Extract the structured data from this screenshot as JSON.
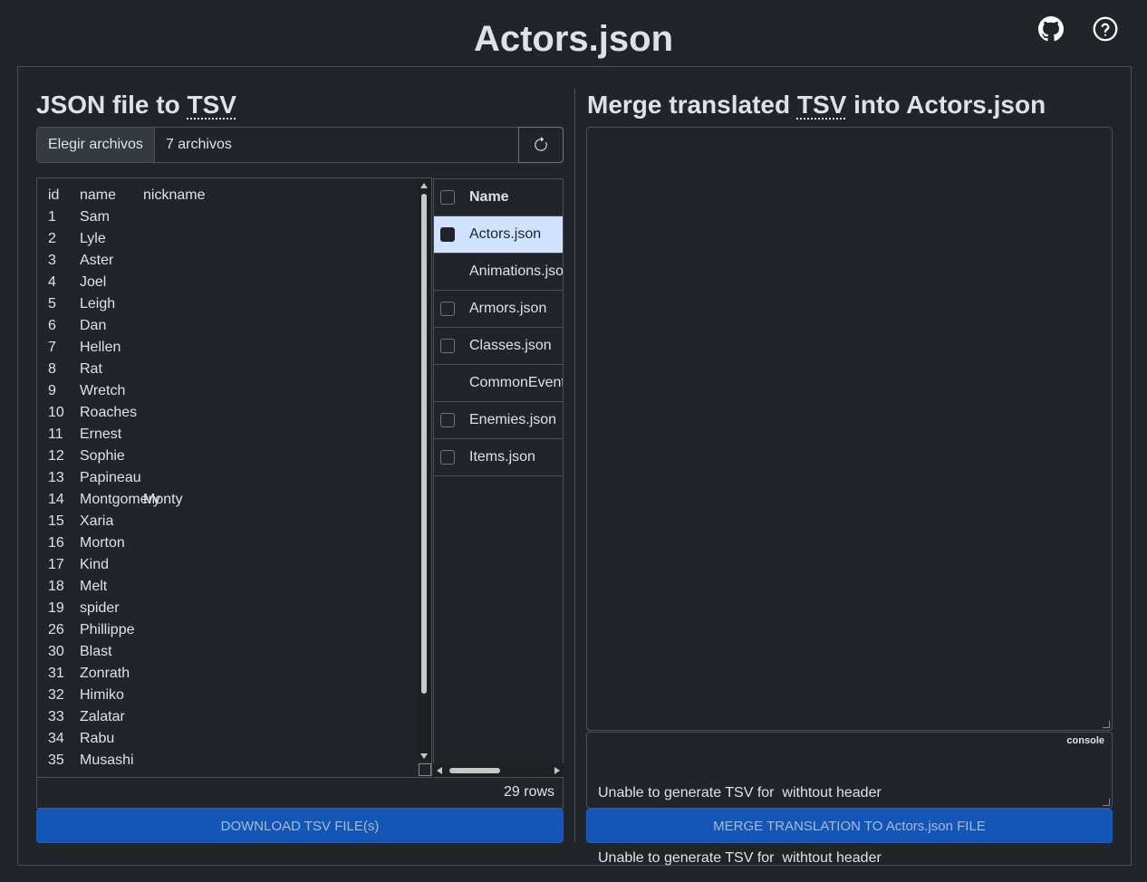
{
  "app": {
    "title": "Actors.json"
  },
  "top_icons": [
    {
      "name": "github-icon"
    },
    {
      "name": "help-circle-icon"
    }
  ],
  "left": {
    "heading_prefix": "JSON file to ",
    "heading_abbr": "TSV",
    "file_input": {
      "button_label": "Elegir archivos",
      "value_text": "7 archivos"
    },
    "refresh_icon": "refresh-icon",
    "tsv": {
      "headers": [
        "id",
        "name",
        "nickname"
      ],
      "rows": [
        [
          "1",
          "Sam",
          ""
        ],
        [
          "2",
          "Lyle",
          ""
        ],
        [
          "3",
          "Aster",
          ""
        ],
        [
          "4",
          "Joel",
          ""
        ],
        [
          "5",
          "Leigh",
          ""
        ],
        [
          "6",
          "Dan",
          ""
        ],
        [
          "7",
          "Hellen",
          ""
        ],
        [
          "8",
          "Rat",
          ""
        ],
        [
          "9",
          "Wretch",
          ""
        ],
        [
          "10",
          "Roaches",
          ""
        ],
        [
          "11",
          "Ernest",
          ""
        ],
        [
          "12",
          "Sophie",
          ""
        ],
        [
          "13",
          "Papineau",
          ""
        ],
        [
          "14",
          "Montgomery",
          "Monty"
        ],
        [
          "15",
          "Xaria",
          ""
        ],
        [
          "16",
          "Morton",
          ""
        ],
        [
          "17",
          "Kind",
          ""
        ],
        [
          "18",
          "Melt",
          ""
        ],
        [
          "19",
          "spider",
          ""
        ],
        [
          "26",
          "Phillippe",
          ""
        ],
        [
          "30",
          "Blast",
          ""
        ],
        [
          "31",
          "Zonrath",
          ""
        ],
        [
          "32",
          "Himiko",
          ""
        ],
        [
          "33",
          "Zalatar",
          ""
        ],
        [
          "34",
          "Rabu",
          ""
        ],
        [
          "35",
          "Musashi",
          ""
        ]
      ]
    },
    "row_count": "29 rows",
    "download_button": "DOWNLOAD TSV FILE(s)"
  },
  "file_list": {
    "header": "Name",
    "items": [
      {
        "label": "Actors.json",
        "selected": true,
        "has_checkbox": true
      },
      {
        "label": "Animations.json",
        "selected": false,
        "has_checkbox": false
      },
      {
        "label": "Armors.json",
        "selected": false,
        "has_checkbox": true
      },
      {
        "label": "Classes.json",
        "selected": false,
        "has_checkbox": true
      },
      {
        "label": "CommonEvents.json",
        "selected": false,
        "has_checkbox": false
      },
      {
        "label": "Enemies.json",
        "selected": false,
        "has_checkbox": true
      },
      {
        "label": "Items.json",
        "selected": false,
        "has_checkbox": true
      }
    ]
  },
  "right": {
    "heading_prefix": "Merge translated ",
    "heading_abbr": "TSV",
    "heading_suffix": " into Actors.json",
    "textarea_value": "",
    "console": {
      "label": "console",
      "lines": [
        "Unable to generate TSV for  withtout header",
        "Unable to generate TSV for  withtout header"
      ]
    },
    "merge_button": "MERGE TRANSLATION TO Actors.json FILE"
  }
}
